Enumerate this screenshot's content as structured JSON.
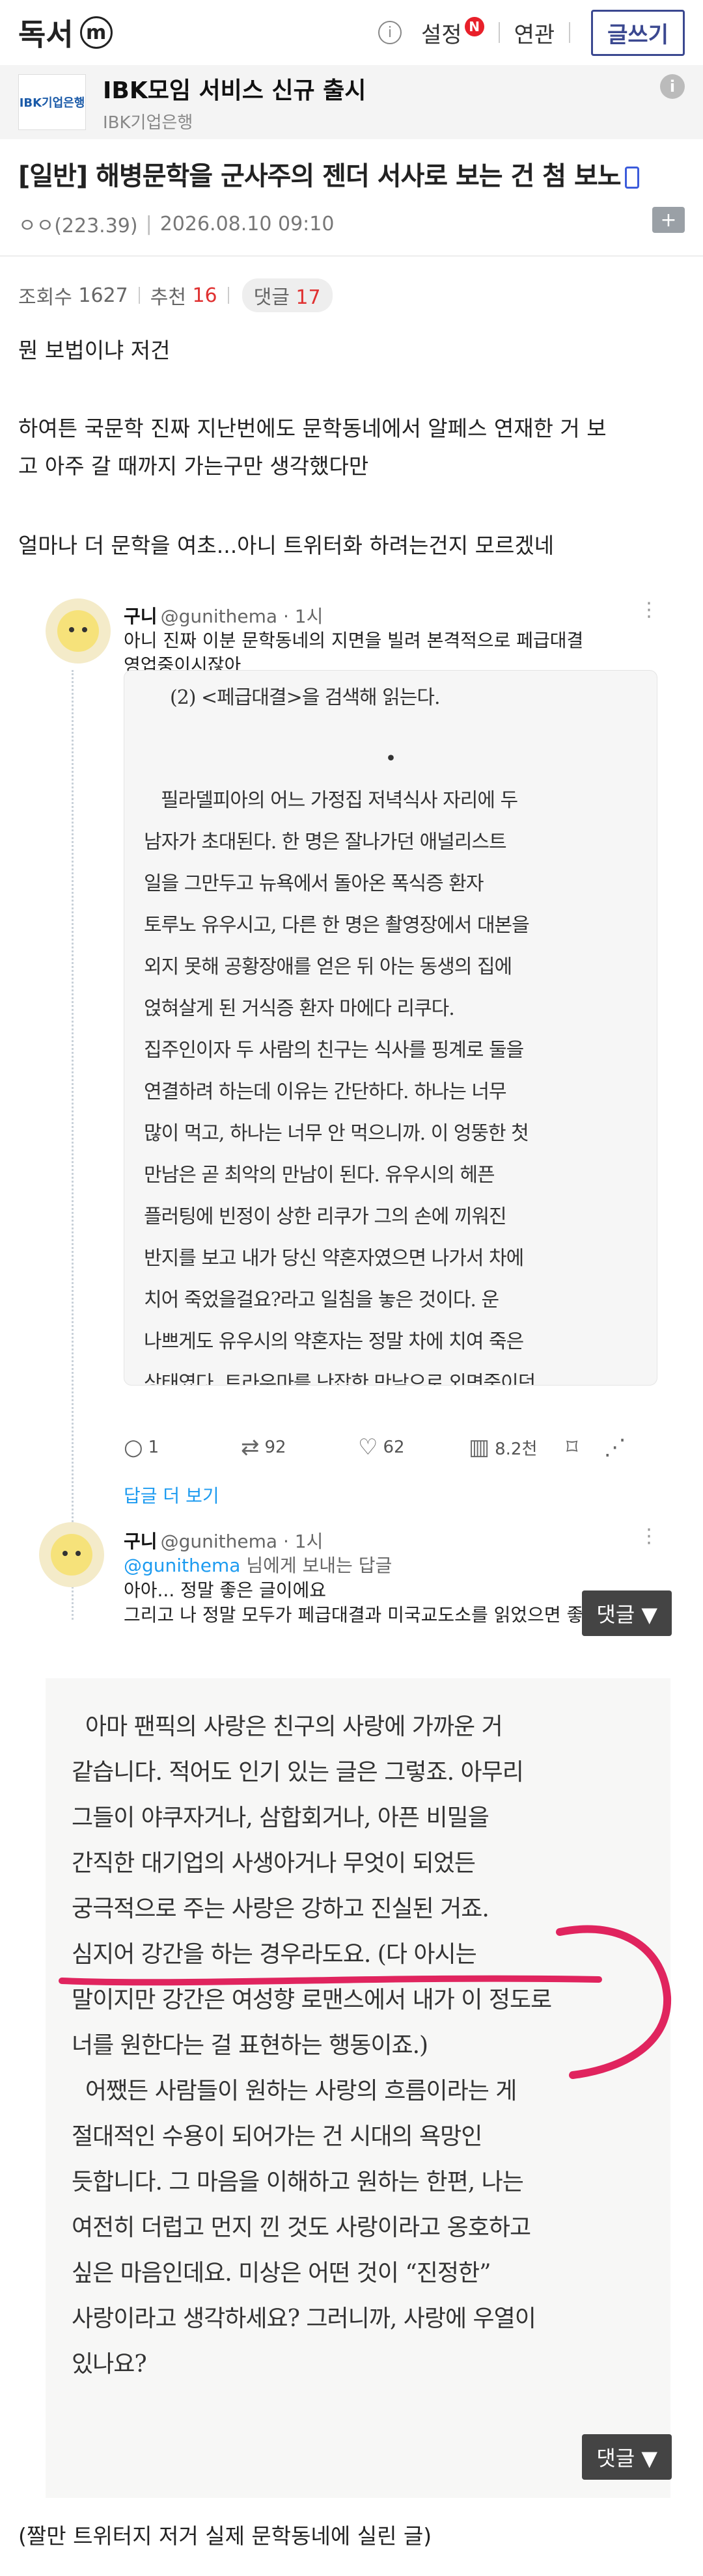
{
  "header": {
    "gallery_name": "독서",
    "minor_badge": "ⓜ",
    "info_icon": "ⓘ",
    "settings_label": "설정",
    "new_badge": "N",
    "related_label": "연관",
    "write_button": "글쓰기"
  },
  "ad": {
    "logo_text": "IBK기업은행",
    "title": "IBK모임 서비스 신규 출시",
    "sub": "IBK기업은행",
    "info_icon": "i"
  },
  "post": {
    "title": "[일반] 해병문학을 군사주의 젠더 서사로 보는 건 첨 보노",
    "author": "ㅇㅇ(223.39)",
    "datetime": "2026.08.10 09:10",
    "views_label": "조회수",
    "views": "1627",
    "recommend_label": "추천",
    "recommend": "16",
    "comment_label": "댓글",
    "comment": "17",
    "lines": [
      "뭔 보법이냐 저건",
      "하여튼 국문학 진짜 지난번에도 문학동네에서 알페스 연재한 거 보",
      "고 아주 갈 때까지 가는구만 생각했다만",
      "얼마나 더 문학을 여초...아니 트위터화 하려는건지 모르겠네"
    ],
    "footer": "(짤만 트위터지 저거 실제 문학동네에 실린 글)"
  },
  "tweet1": {
    "name": "구니",
    "handle": "@gunithema · 1시",
    "text1": "아니 진짜 이분 문학동네의 지면을 빌려 본격적으로 페급대결",
    "text2": "영업중이시잖아",
    "book_lines": [
      "(2) <페급대결>을 검색해 읽는다.",
      "•",
      "",
      "필라델피아의 어느 가정집 저녁식사 자리에 두",
      "남자가 초대된다. 한 명은 잘나가던 애널리스트",
      "일을 그만두고 뉴욕에서 돌아온 폭식증 환자",
      "토루노 유우시고, 다른 한 명은 촬영장에서 대본을",
      "외지 못해 공황장애를 얻은 뒤 아는 동생의 집에",
      "얹혀살게 된 거식증 환자 마에다 리쿠다.",
      "집주인이자 두 사람의 친구는 식사를 핑계로 둘을",
      "연결하려 하는데 이유는 간단하다. 하나는 너무",
      "많이 먹고, 하나는 너무 안 먹으니까. 이 엉뚱한 첫",
      "만남은 곧 최악의 만남이 된다. 유우시의 헤픈",
      "플러팅에 빈정이 상한 리쿠가 그의 손에 끼워진",
      "반지를 보고 내가 당신 약혼자였으면 나가서 차에",
      "치어 죽었을걸요?라고 일침을 놓은 것이다. 운",
      "나쁘게도 유우시의 약혼자는 정말 차에 치여 죽은",
      "상태였다. 트라우마를 난잡한 만남으로 외면중이던"
    ],
    "reply_count": "1",
    "retweets": "92",
    "likes": "62",
    "views": "8.2천",
    "reply_more": "답글 더 보기"
  },
  "tweet2": {
    "name": "구니",
    "handle": "@gunithema · 1시",
    "reply_to_handle": "@gunithema",
    "reply_to_suffix": " 님에게 보내는 답글",
    "text1": "아아... 정말 좋은 글이에요",
    "text2": "그리고 나 정말 모두가 페급대결과 미국교도소를 읽었으면 좋겠어"
  },
  "comment_float": "댓글 ▼",
  "scan2": {
    "lines": [
      "  아마 팬픽의 사랑은 친구의 사랑에 가까운 거",
      "같습니다. 적어도 인기 있는 글은 그렇죠. 아무리",
      "그들이 야쿠자거나, 삼합회거나, 아픈 비밀을",
      "간직한 대기업의 사생아거나 무엇이 되었든",
      "궁극적으로 주는 사랑은 강하고 진실된 거죠.",
      "심지어 강간을 하는 경우라도요. (다 아시는",
      "말이지만 강간은 여성향 로맨스에서 내가 이 정도로",
      "너를 원한다는 걸 표현하는 행동이죠.)",
      "  어쨌든 사람들이 원하는 사랑의 흐름이라는 게",
      "절대적인 수용이 되어가는 건 시대의 욕망인",
      "듯합니다. 그 마음을 이해하고 원하는 한편, 나는",
      "여전히 더럽고 먼지 낀 것도 사랑이라고 옹호하고",
      "싶은 마음인데요. 미상은 어떤 것이 “진정한”",
      "사랑이라고 생각하세요? 그러니까, 사랑에 우열이",
      "있나요?"
    ]
  },
  "colors": {
    "accent": "#3b4890",
    "red": "#e03131",
    "link": "#1d9bf0"
  }
}
